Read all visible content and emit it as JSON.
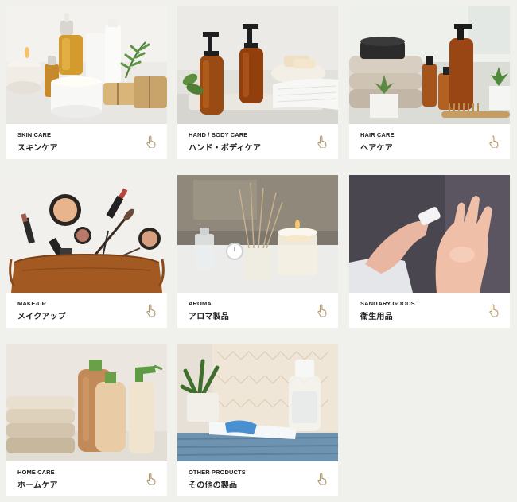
{
  "categories": [
    {
      "en": "SKIN CARE",
      "jp": "スキンケア",
      "icon": "hand-pointer-icon"
    },
    {
      "en": "HAND / BODY CARE",
      "jp": "ハンド・ボディケア",
      "icon": "hand-pointer-icon"
    },
    {
      "en": "HAIR CARE",
      "jp": "ヘアケア",
      "icon": "hand-pointer-icon"
    },
    {
      "en": "MAKE-UP",
      "jp": "メイクアップ",
      "icon": "hand-pointer-icon"
    },
    {
      "en": "AROMA",
      "jp": "アロマ製品",
      "icon": "hand-pointer-icon"
    },
    {
      "en": "SANITARY GOODS",
      "jp": "衛生用品",
      "icon": "hand-pointer-icon"
    },
    {
      "en": "HOME CARE",
      "jp": "ホームケア",
      "icon": "hand-pointer-icon"
    },
    {
      "en": "OTHER PRODUCTS",
      "jp": "その他の製品",
      "icon": "hand-pointer-icon"
    }
  ],
  "colors": {
    "background": "#f0f0ec",
    "card": "#ffffff",
    "hand_icon": "#b59a6a",
    "text": "#222222"
  }
}
